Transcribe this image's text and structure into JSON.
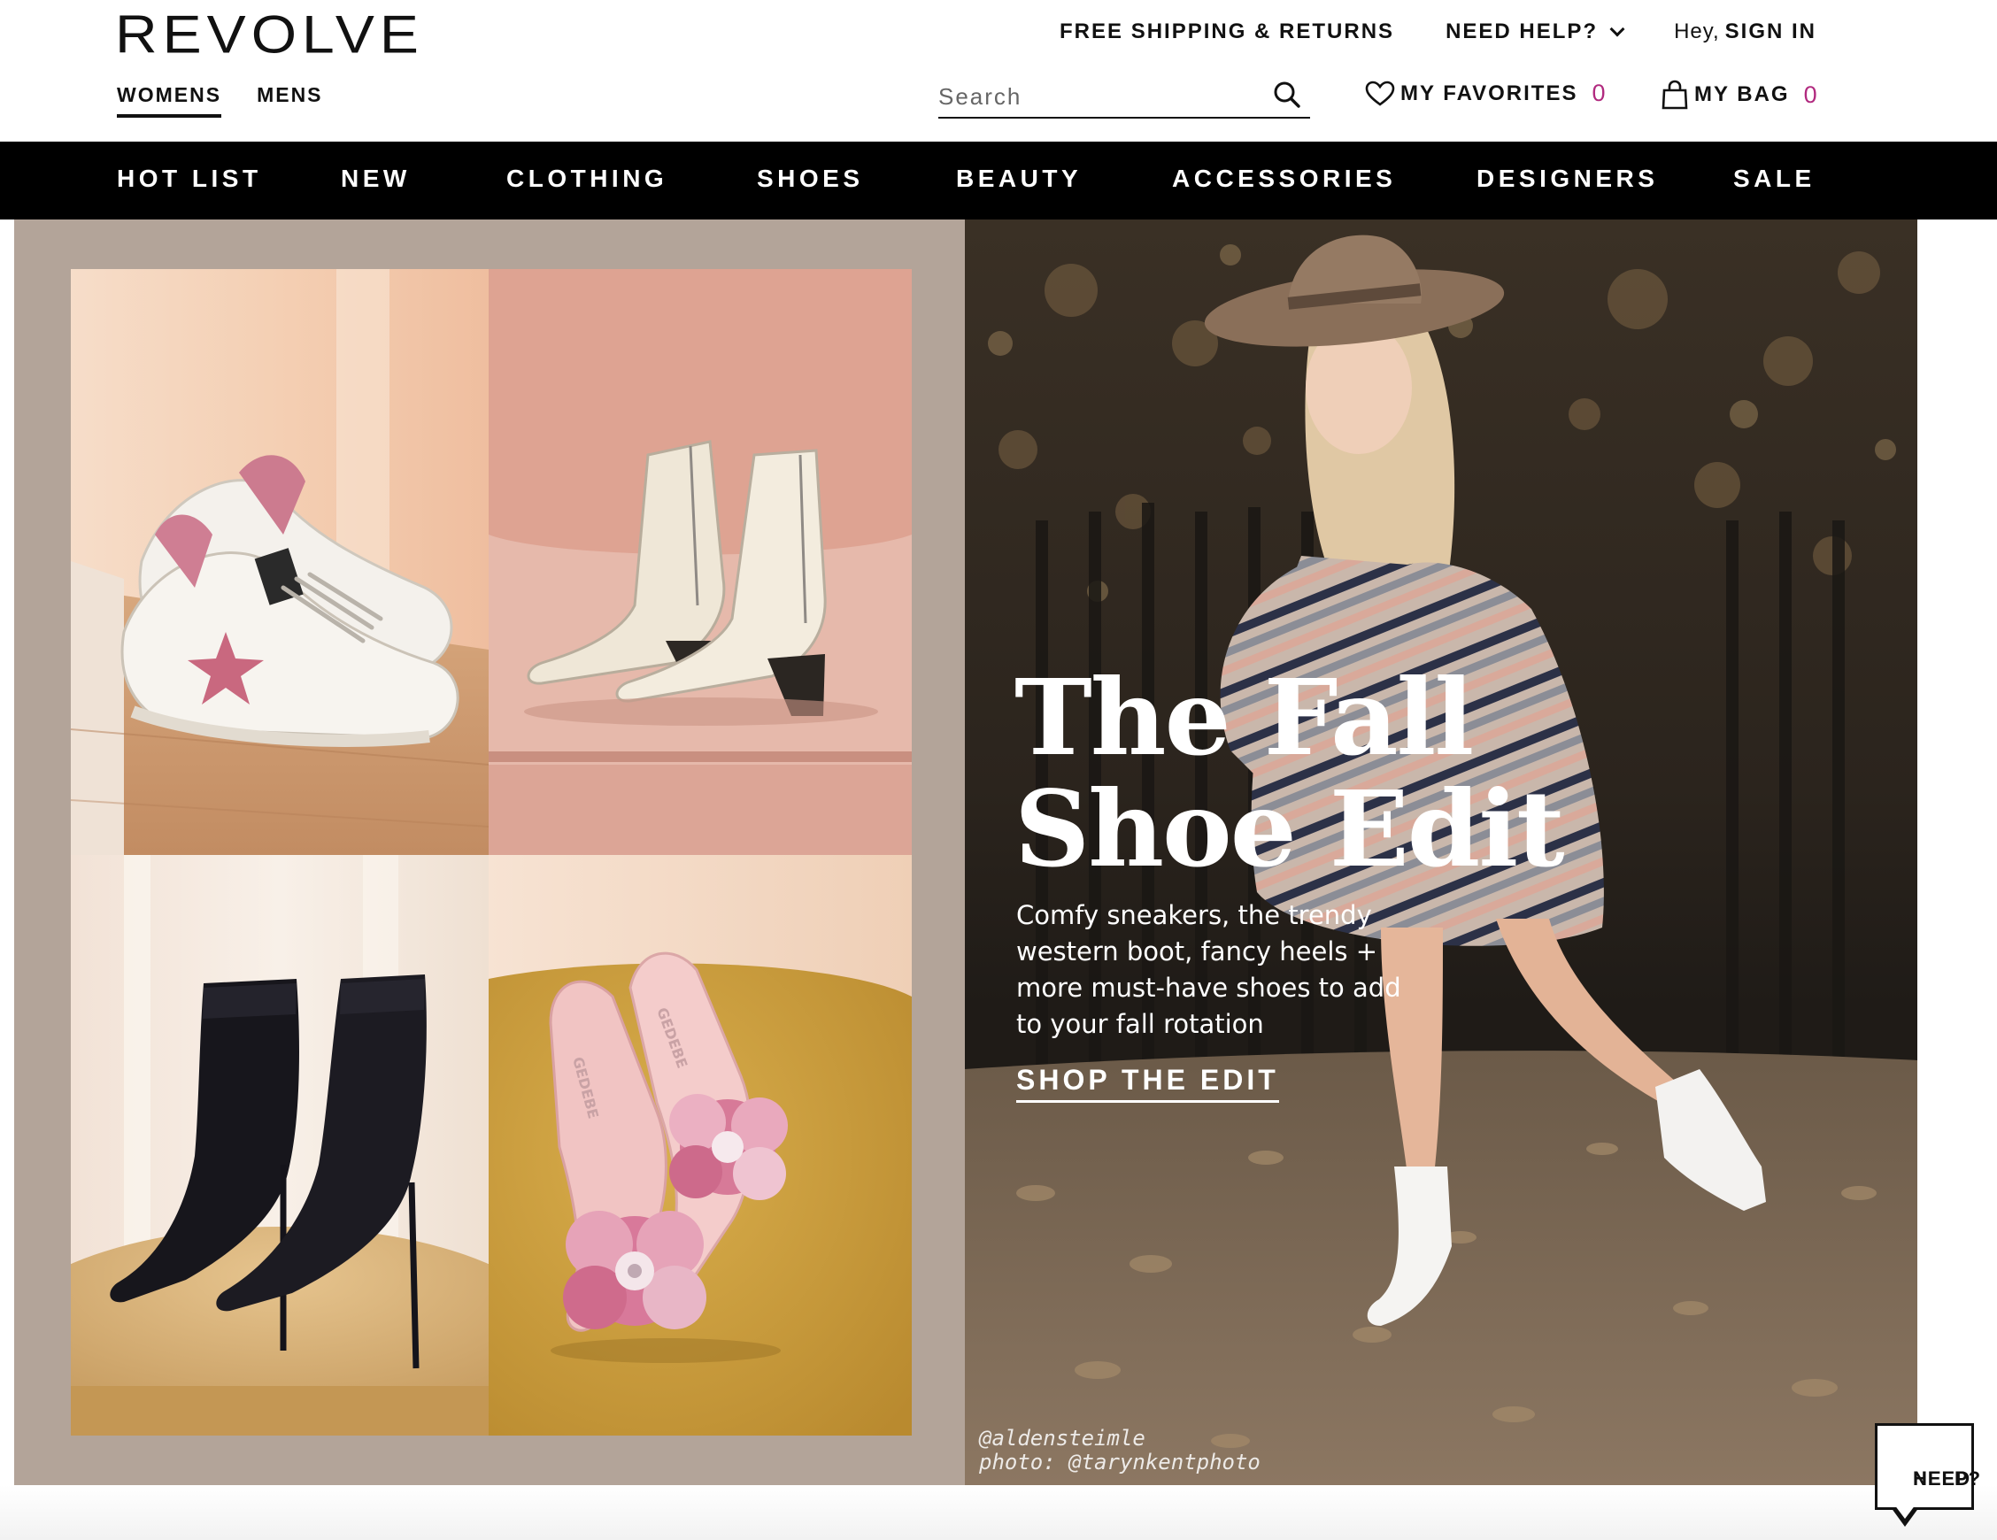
{
  "header": {
    "logo": "REVOLVE",
    "gender_tabs": [
      {
        "label": "WOMENS",
        "active": true
      },
      {
        "label": "MENS",
        "active": false
      }
    ],
    "utility": {
      "shipping": "FREE SHIPPING & RETURNS",
      "help": "NEED HELP?",
      "greeting": "Hey,",
      "signin": "SIGN IN"
    },
    "search": {
      "placeholder": "Search",
      "value": ""
    },
    "favorites": {
      "label": "MY FAVORITES",
      "count": "0"
    },
    "bag": {
      "label": "MY BAG",
      "count": "0"
    },
    "icons": [
      "search-icon",
      "heart-icon",
      "bag-icon",
      "chevron-down-icon"
    ]
  },
  "catnav": {
    "items": [
      "HOT LIST",
      "NEW",
      "CLOTHING",
      "SHOES",
      "BEAUTY",
      "ACCESSORIES",
      "DESIGNERS",
      "SALE"
    ]
  },
  "hero": {
    "headline_line1": "The Fall",
    "headline_line2": "Shoe Edit",
    "subcopy": "Comfy sneakers, the trendy western boot, fancy heels + more must-have shoes to add to your fall rotation",
    "cta": "SHOP THE EDIT",
    "credit_line1": "@aldensteimle",
    "credit_line2": "photo: @tarynkentphoto",
    "shoe_brand_text": "GEDEBE",
    "colors": {
      "frame": "#b3a499",
      "accent_pink": "#b12a7f"
    }
  },
  "help_widget": {
    "line1": "NEED",
    "line2": "HELP?"
  }
}
